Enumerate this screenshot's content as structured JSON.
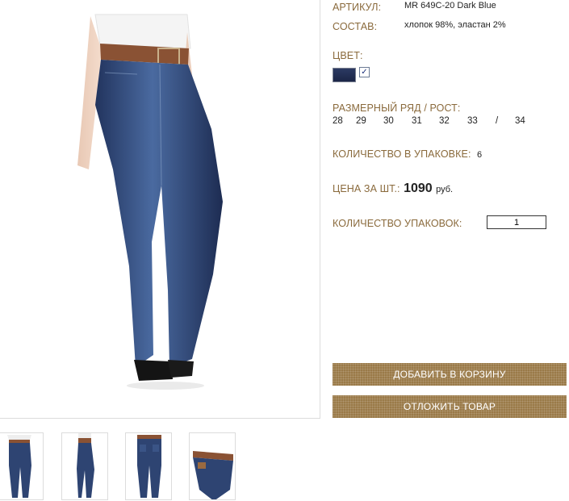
{
  "product": {
    "article_label": "АРТИКУЛ:",
    "article_value": "MR 649C-20 Dark Blue",
    "composition_label": "СОСТАВ:",
    "composition_value": "хлопок 98%, эластан 2%",
    "color_label": "ЦВЕТ:",
    "color_swatch": "#24305a",
    "color_selected": true,
    "size_label": "РАЗМЕРНЫЙ РЯД / РОСТ:",
    "sizes": [
      "28",
      "29",
      "30",
      "31",
      "32",
      "33",
      "/",
      "34"
    ],
    "pack_qty_label": "КОЛИЧЕСТВО В УПАКОВКЕ:",
    "pack_qty_value": "6",
    "price_label": "ЦЕНА ЗА ШТ.:",
    "price_value": "1090",
    "price_currency": "руб.",
    "packs_label": "КОЛИЧЕСТВО УПАКОВОК:",
    "packs_value": "1"
  },
  "buttons": {
    "add_to_cart": "ДОБАВИТЬ В КОРЗИНУ",
    "save_for_later": "ОТЛОЖИТЬ ТОВАР"
  },
  "colors": {
    "label": "#8a6a3c",
    "button": "#9a7a48",
    "denim": "#2e4472"
  },
  "thumbnails": [
    {
      "name": "front-view"
    },
    {
      "name": "side-view"
    },
    {
      "name": "back-view"
    },
    {
      "name": "waist-detail"
    }
  ]
}
